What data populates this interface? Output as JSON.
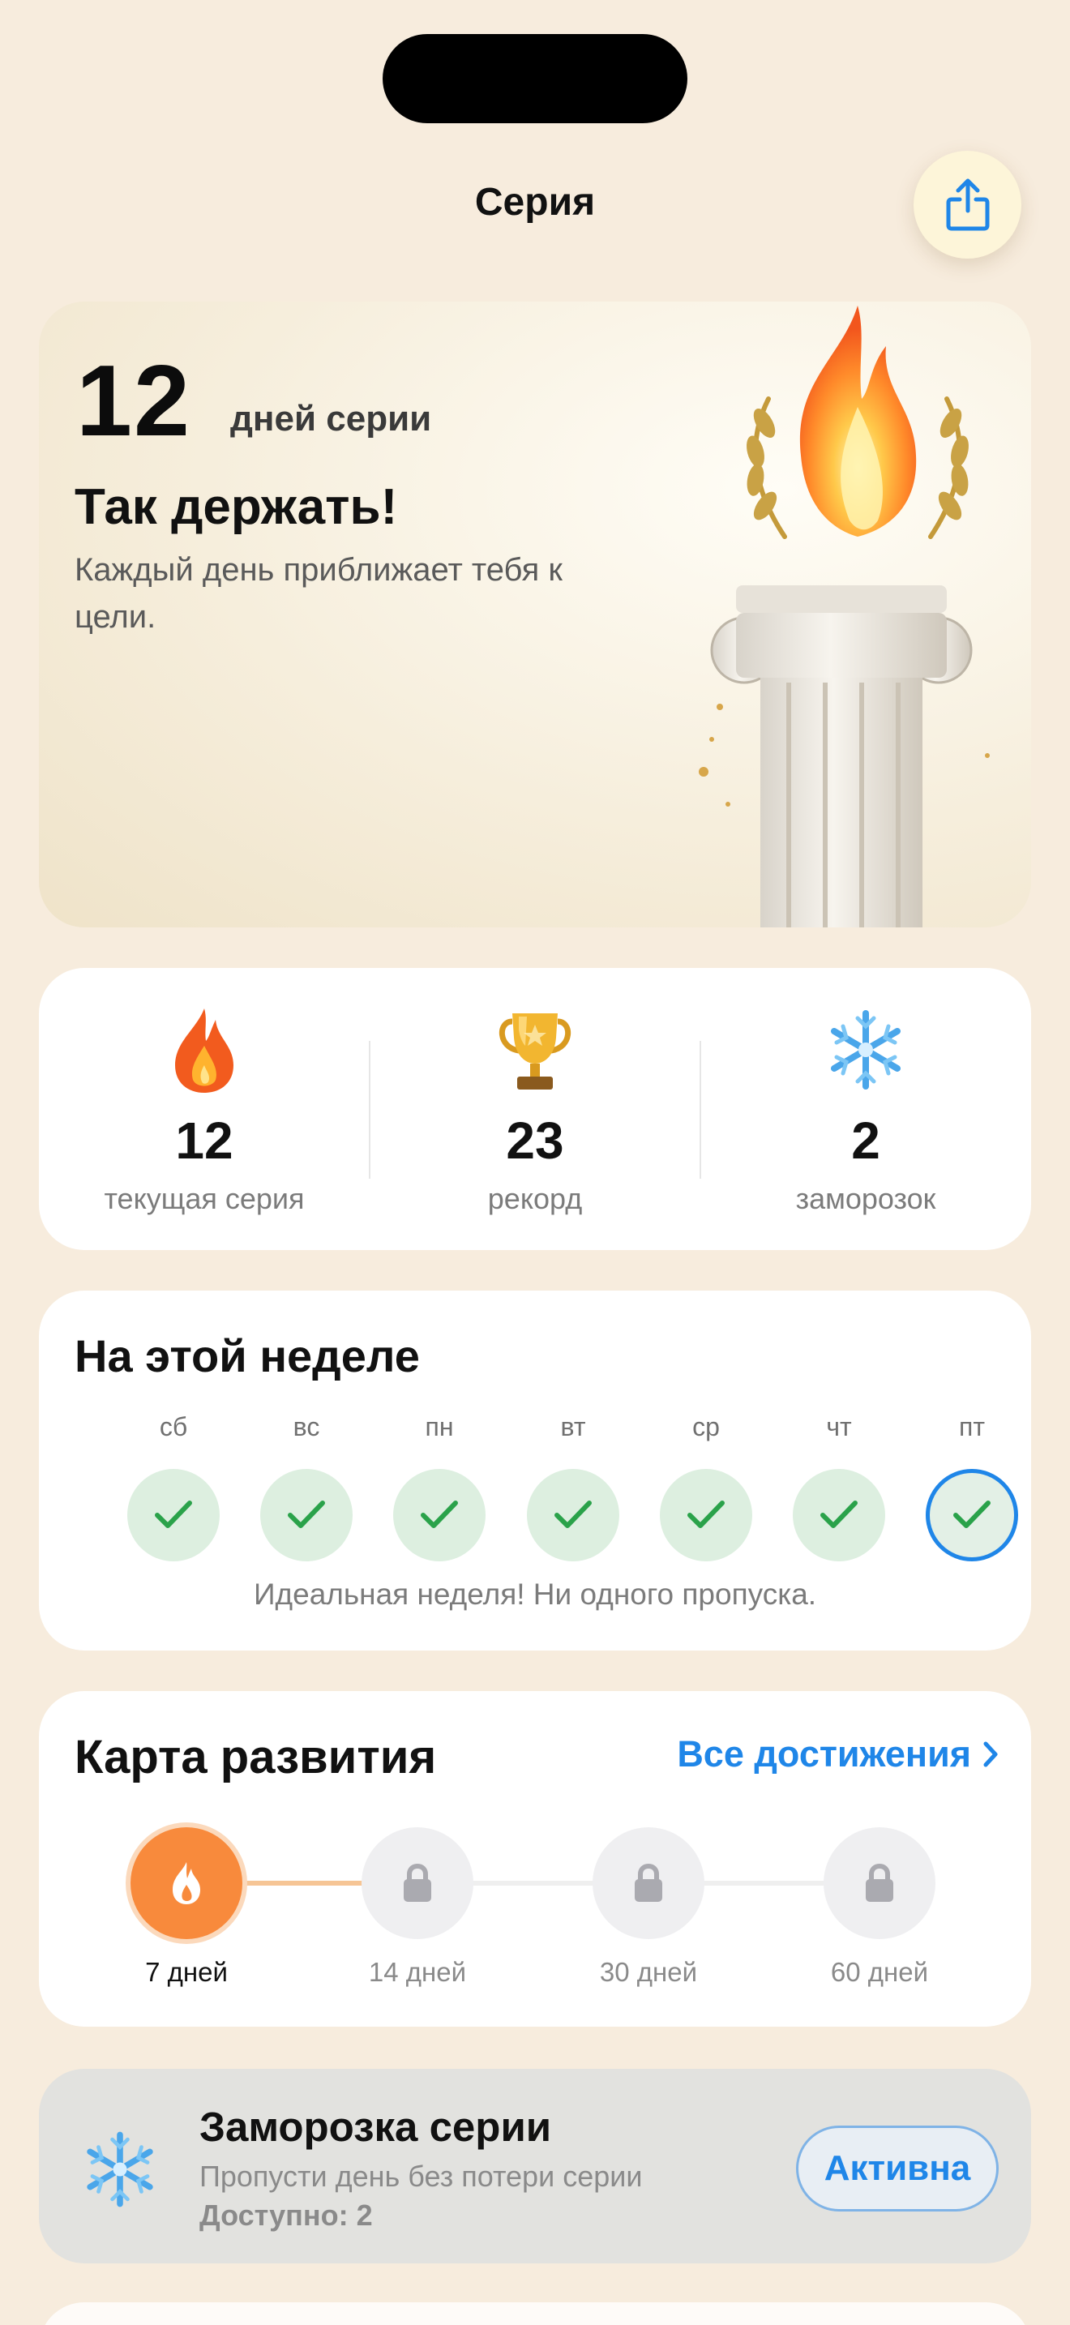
{
  "header": {
    "title": "Серия",
    "share_icon": "share-icon"
  },
  "hero": {
    "streak_number": "12",
    "streak_label": "дней серии",
    "title": "Так держать!",
    "subtitle": "Каждый день приближает тебя к цели.",
    "illustration": "torch-column-laurel"
  },
  "stats": [
    {
      "icon": "fire-icon",
      "value": "12",
      "label": "текущая серия"
    },
    {
      "icon": "trophy-icon",
      "value": "23",
      "label": "рекорд"
    },
    {
      "icon": "snowflake-icon",
      "value": "2",
      "label": "заморозок"
    }
  ],
  "week": {
    "title": "На этой неделе",
    "days": [
      {
        "label": "сб",
        "done": true
      },
      {
        "label": "вс",
        "done": true
      },
      {
        "label": "пн",
        "done": true
      },
      {
        "label": "вт",
        "done": true
      },
      {
        "label": "ср",
        "done": true
      },
      {
        "label": "чт",
        "done": true
      },
      {
        "label": "пт",
        "done": true,
        "today": true
      }
    ],
    "note": "Идеальная неделя! Ни одного пропуска."
  },
  "roadmap": {
    "title": "Карта развития",
    "link": "Все достижения",
    "milestones": [
      {
        "label": "7 дней",
        "status": "achieved",
        "icon": "fire-icon"
      },
      {
        "label": "14 дней",
        "status": "locked",
        "icon": "lock-icon"
      },
      {
        "label": "30 дней",
        "status": "locked",
        "icon": "lock-icon"
      },
      {
        "label": "60 дней",
        "status": "locked",
        "icon": "lock-icon"
      }
    ]
  },
  "freeze": {
    "title": "Заморозка серии",
    "subtitle": "Пропусти день без потери серии",
    "available": "Доступно: 2",
    "button": "Активна"
  },
  "colors": {
    "accent": "#1f86e8",
    "background": "#f7ecdd",
    "fire": "#f88a3c",
    "done_bg": "#ddefe0",
    "check": "#2aa24a"
  }
}
